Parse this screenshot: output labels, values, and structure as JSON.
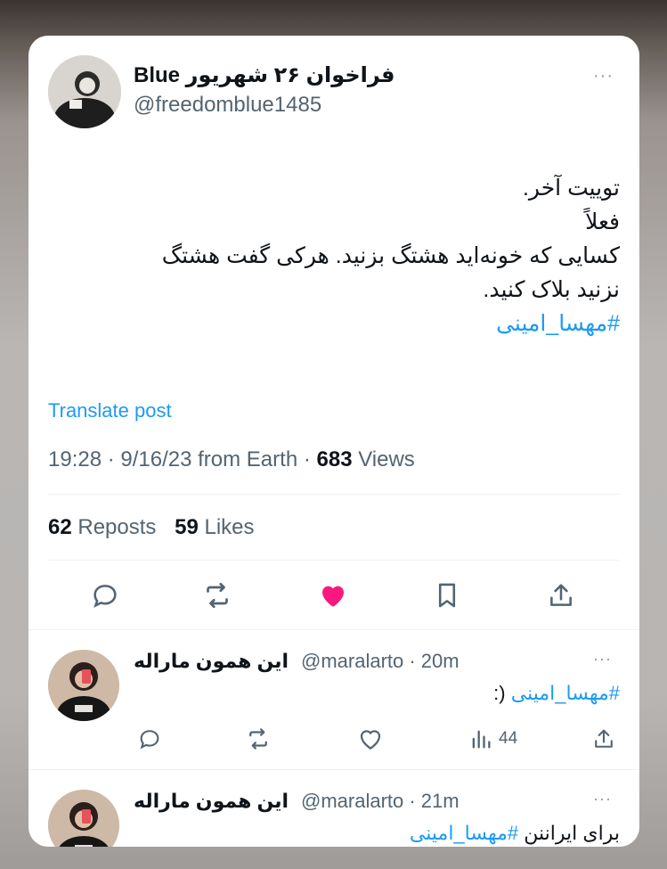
{
  "main_post": {
    "display_name": "فراخوان ۲۶ شهریور Blue",
    "handle": "@freedomblue1485",
    "more_label": "···",
    "text_lines": [
      "توییت آخر.",
      "فعلاً",
      "کسایی که خونه‌اید هشتگ بزنید. هرکی گفت هشتگ",
      "نزنید بلاک کنید."
    ],
    "hashtag": "#مهسا_امینی",
    "translate_label": "Translate post",
    "timestamp": "19:28 · 9/16/23 from Earth · ",
    "views_count": "683",
    "views_label": " Views",
    "reposts_count": "62",
    "reposts_label": " Reposts",
    "likes_count": "59",
    "likes_label": " Likes",
    "liked": true,
    "like_color": "#f91880"
  },
  "replies": [
    {
      "display_name": "این همون ماراله",
      "handle": "@maralarto · 20m",
      "text": "(:",
      "hashtag": "#مهسا_امینی",
      "views": "44",
      "more_label": "···"
    },
    {
      "display_name": "این همون ماراله",
      "handle": "@maralarto · 21m",
      "text": "برای ایراننن",
      "hashtag": "#مهسا_امینی",
      "more_label": "···"
    }
  ],
  "colors": {
    "accent": "#1d9bf0",
    "secondary_text": "#536471",
    "primary_text": "#0f1419"
  }
}
